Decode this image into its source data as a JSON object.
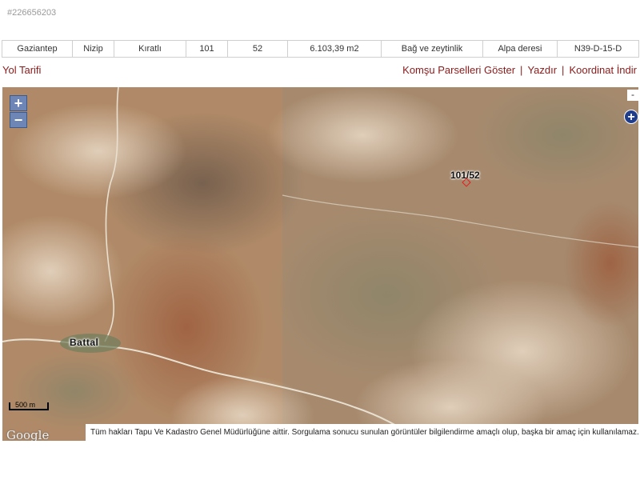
{
  "listing": {
    "id": "#226656203"
  },
  "parcel_info": {
    "cells": [
      "Gaziantep",
      "Nizip",
      "Kıratlı",
      "101",
      "52",
      "6.103,39 m2",
      "Bağ ve zeytinlik",
      "Alpa deresi",
      "N39-D-15-D"
    ]
  },
  "links": {
    "directions": "Yol Tarifi",
    "show_neighbors": "Komşu Parselleri Göster",
    "print": "Yazdır",
    "download_coords": "Koordinat İndir",
    "separator": "|"
  },
  "map": {
    "zoom_in": "+",
    "zoom_out": "−",
    "collapse": "-",
    "layers": "+",
    "parcel_label": "101/52",
    "town_label": "Battal",
    "scale_label": "500 m",
    "google_logo": "Google",
    "attribution": "Tüm hakları Tapu Ve Kadastro Genel Müdürlüğüne aittir. Sorgulama sonucu sunulan görüntüler bilgilendirme amaçlı olup, başka bir amaç için kullanılamaz.",
    "colors": {
      "terrain": "#b58e6c",
      "road": "#e8e0d0",
      "parcel_marker": "#e02020",
      "zoom_button": "#6d86b5",
      "link": "#8b1a1a"
    }
  }
}
